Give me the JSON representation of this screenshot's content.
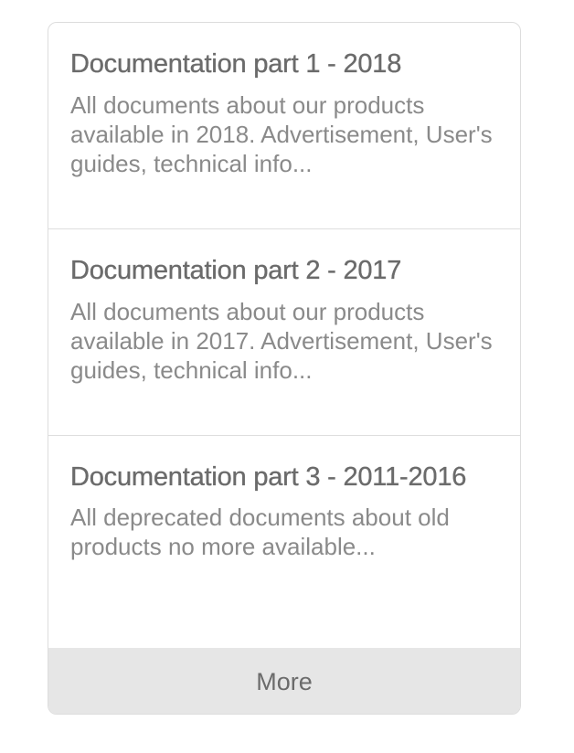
{
  "list": {
    "items": [
      {
        "title": "Documentation part 1 - 2018",
        "description": "All documents about our products available in 2018. Advertisement, User's guides, technical info..."
      },
      {
        "title": "Documentation part 2 - 2017",
        "description": "All documents about our products available in 2017. Advertisement, User's guides, technical info..."
      },
      {
        "title": "Documentation part 3 - 2011-2016",
        "description": "All deprecated documents about old products no more available..."
      }
    ],
    "more_label": "More"
  }
}
